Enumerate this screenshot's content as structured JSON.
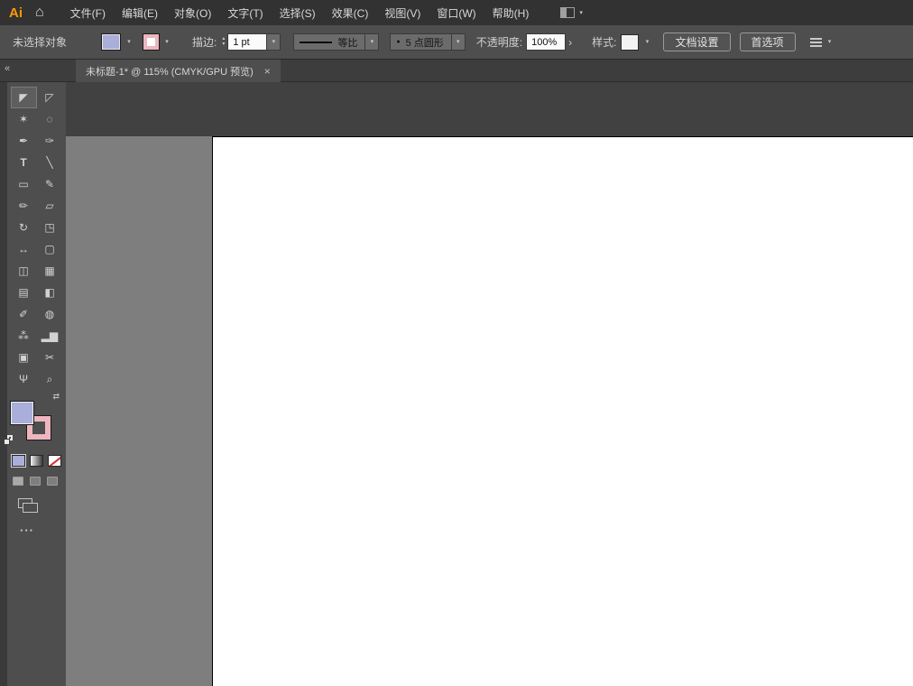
{
  "app": {
    "logo_label": "Ai"
  },
  "icons": {
    "home": "⌂",
    "caret": "▾",
    "collapse_chevrons": "«",
    "tab_close": "×",
    "stepper_up": "▴",
    "stepper_down": "▾",
    "opacity_more": "›",
    "brush_dot": "●",
    "swap_arrows": "⇄",
    "more_dots": "···"
  },
  "menu_bar": {
    "items": [
      "文件(F)",
      "编辑(E)",
      "对象(O)",
      "文字(T)",
      "选择(S)",
      "效果(C)",
      "视图(V)",
      "窗口(W)",
      "帮助(H)"
    ]
  },
  "control_bar": {
    "selection_status": "未选择对象",
    "fill_color": "#a9aeda",
    "stroke_color": "#edb6bf",
    "stroke_label": "描边:",
    "stroke_weight_value": "1 pt",
    "stroke_profile": "等比",
    "brush_name": "5 点圆形",
    "opacity_label": "不透明度:",
    "opacity_value": "100%",
    "style_label": "样式:",
    "document_setup_button": "文档设置",
    "preferences_button": "首选项"
  },
  "tab_bar": {
    "active_tab": {
      "title": "未标题-1* @ 115% (CMYK/GPU 预览)"
    }
  },
  "toolbar": {
    "fill_color": "#a9aeda",
    "stroke_color": "#edb6bf",
    "tools": [
      {
        "name": "selection-tool",
        "glyph": "◤"
      },
      {
        "name": "direct-selection-tool",
        "glyph": "◸"
      },
      {
        "name": "magic-wand-tool",
        "glyph": "✶"
      },
      {
        "name": "lasso-tool",
        "glyph": "◌"
      },
      {
        "name": "pen-tool",
        "glyph": "✒"
      },
      {
        "name": "curvature-tool",
        "glyph": "✑"
      },
      {
        "name": "type-tool",
        "glyph": "T"
      },
      {
        "name": "line-segment-tool",
        "glyph": "╲"
      },
      {
        "name": "rectangle-tool",
        "glyph": "▭"
      },
      {
        "name": "paintbrush-tool",
        "glyph": "✎"
      },
      {
        "name": "shaper-tool",
        "glyph": "✏"
      },
      {
        "name": "eraser-tool",
        "glyph": "▱"
      },
      {
        "name": "rotate-tool",
        "glyph": "↻"
      },
      {
        "name": "scale-tool",
        "glyph": "◳"
      },
      {
        "name": "width-tool",
        "glyph": "↔"
      },
      {
        "name": "free-transform-tool",
        "glyph": "▢"
      },
      {
        "name": "shape-builder-tool",
        "glyph": "◫"
      },
      {
        "name": "perspective-grid-tool",
        "glyph": "▦"
      },
      {
        "name": "mesh-tool",
        "glyph": "▤"
      },
      {
        "name": "gradient-tool",
        "glyph": "◧"
      },
      {
        "name": "eyedropper-tool",
        "glyph": "✐"
      },
      {
        "name": "blend-tool",
        "glyph": "◍"
      },
      {
        "name": "symbol-sprayer-tool",
        "glyph": "⁂"
      },
      {
        "name": "column-graph-tool",
        "glyph": "▂▆"
      },
      {
        "name": "artboard-tool",
        "glyph": "▣"
      },
      {
        "name": "slice-tool",
        "glyph": "✂"
      },
      {
        "name": "hand-tool",
        "glyph": "Ψ"
      },
      {
        "name": "zoom-tool",
        "glyph": "⌕"
      }
    ]
  },
  "canvas": {
    "pasteboard_color": "#7e7e7e",
    "artboard_color": "#ffffff"
  }
}
